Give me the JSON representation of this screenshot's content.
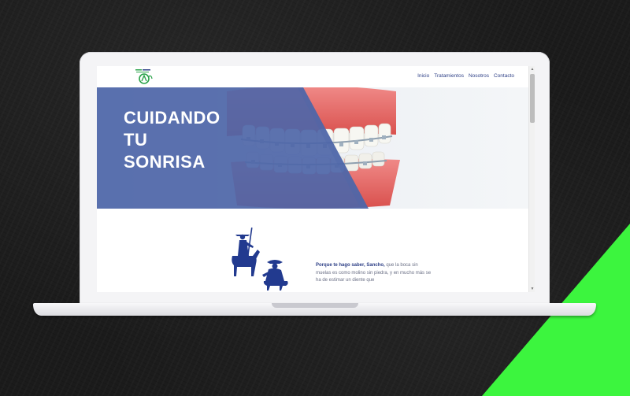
{
  "nav": {
    "items": [
      "Inicio",
      "Tratamientos",
      "Nosotros",
      "Contacto"
    ]
  },
  "hero": {
    "title_lines": [
      "CUIDANDO",
      "TU",
      "SONRISA"
    ]
  },
  "quote": {
    "bold": "Porque te hago saber, Sancho,",
    "rest": " que la boca sin muelas es como molino sin piedra, y en mucho más se ha de estimar un diente que"
  },
  "colors": {
    "brand_blue": "#2d3f86",
    "hero_overlay": "#4e66a8",
    "accent_green": "#3cf53e",
    "logo_green": "#2aa34a"
  }
}
